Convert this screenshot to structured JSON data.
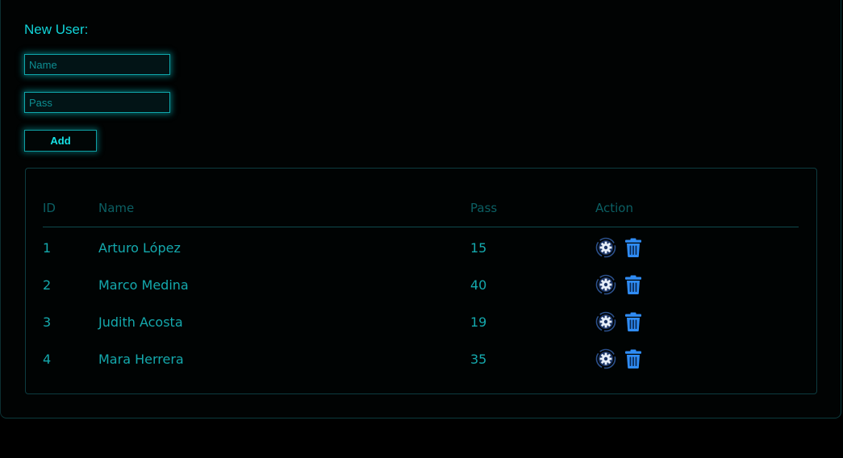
{
  "form": {
    "title": "New User:",
    "name_placeholder": "Name",
    "name_value": "",
    "pass_placeholder": "Pass",
    "pass_value": "",
    "add_label": "Add"
  },
  "table": {
    "headers": [
      "ID",
      "Name",
      "Pass",
      "Action"
    ],
    "rows": [
      {
        "id": "1",
        "name": "Arturo López",
        "pass": "15"
      },
      {
        "id": "2",
        "name": "Marco Medina",
        "pass": "40"
      },
      {
        "id": "3",
        "name": "Judith Acosta",
        "pass": "19"
      },
      {
        "id": "4",
        "name": "Mara Herrera",
        "pass": "35"
      }
    ],
    "action_icons": [
      "settings-icon",
      "trash-icon"
    ]
  },
  "colors": {
    "accent": "#11d4d8",
    "header_text": "#0b5f63",
    "cell_text": "#14a9ad",
    "trash_blue": "#2f8cf5",
    "background": "#000000"
  }
}
